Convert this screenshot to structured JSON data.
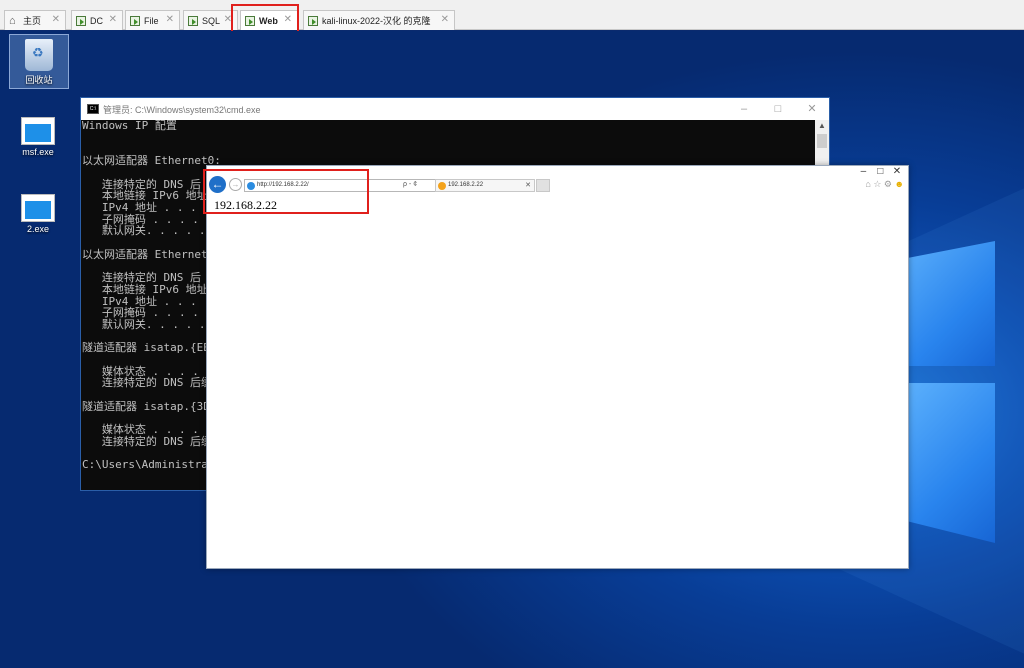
{
  "tabs": [
    {
      "label": "主页",
      "icon": "home-icon"
    },
    {
      "label": "DC",
      "icon": "vm-icon"
    },
    {
      "label": "File",
      "icon": "vm-icon"
    },
    {
      "label": "SQL",
      "icon": "vm-icon"
    },
    {
      "label": "Web",
      "icon": "vm-icon",
      "active": true
    },
    {
      "label": "kali-linux-2022-汉化 的克隆",
      "icon": "vm-icon"
    }
  ],
  "desktop": {
    "icons": [
      {
        "label": "回收站",
        "icon": "recycle-bin-icon"
      },
      {
        "label": "msf.exe",
        "icon": "exe-file-icon"
      },
      {
        "label": "2.exe",
        "icon": "exe-file-icon"
      }
    ]
  },
  "cmd": {
    "title": "管理员: C:\\Windows\\system32\\cmd.exe",
    "lines": [
      "Windows IP 配置",
      "",
      "",
      "以太网适配器 Ethernet0:",
      "",
      "   连接特定的 DNS 后",
      "   本地链接 IPv6 地址",
      "   IPv4 地址 . . . .",
      "   子网掩码 . . . .",
      "   默认网关. . . . .",
      "",
      "以太网适配器 Ethernet",
      "",
      "   连接特定的 DNS 后",
      "   本地链接 IPv6 地址",
      "   IPv4 地址 . . . .",
      "   子网掩码 . . . .",
      "   默认网关. . . . .",
      "",
      "隧道适配器 isatap.{EB",
      "",
      "   媒体状态 . . . .",
      "   连接特定的 DNS 后缀",
      "",
      "隧道适配器 isatap.{3D",
      "",
      "   媒体状态 . . . .",
      "   连接特定的 DNS 后缀",
      "",
      "C:\\Users\\Administrato"
    ]
  },
  "ie": {
    "address": "http://192.168.2.22/",
    "address_btns": "ρ - ¢",
    "tab_label": "192.168.2.22",
    "content_text": "192.168.2.22",
    "win_btns": [
      "–",
      "□",
      "✕"
    ]
  }
}
